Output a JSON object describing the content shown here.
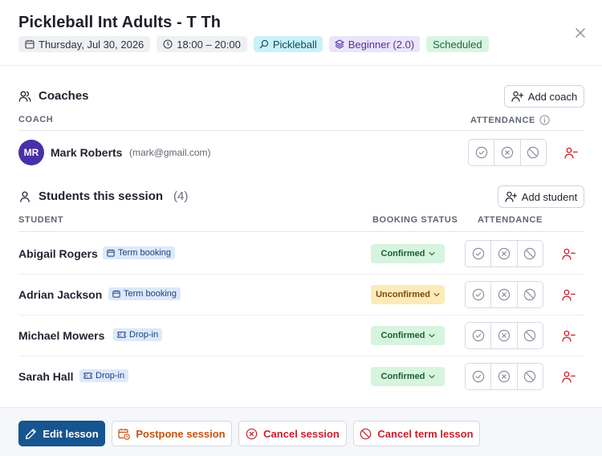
{
  "lesson": {
    "title": "Pickleball Int Adults - T Th",
    "date": "Thursday, Jul 30, 2026",
    "time": "18:00 – 20:00",
    "sport": "Pickleball",
    "level": "Beginner (2.0)",
    "status": "Scheduled"
  },
  "coaches": {
    "heading": "Coaches",
    "add_label": "Add coach",
    "col_coach": "COACH",
    "col_attendance": "ATTENDANCE",
    "items": [
      {
        "initials": "MR",
        "name": "Mark Roberts",
        "email": "(mark@gmail.com)"
      }
    ]
  },
  "students": {
    "heading": "Students this session",
    "count": "(4)",
    "add_label": "Add student",
    "col_student": "STUDENT",
    "col_booking_status": "BOOKING STATUS",
    "col_attendance": "ATTENDANCE",
    "items": [
      {
        "name": "Abigail Rogers",
        "booking_type": "Term booking",
        "booking_status": "Confirmed"
      },
      {
        "name": "Adrian Jackson",
        "booking_type": "Term booking",
        "booking_status": "Unconfirmed"
      },
      {
        "name": "Michael Mowers",
        "booking_type": "Drop-in",
        "booking_status": "Confirmed"
      },
      {
        "name": "Sarah Hall",
        "booking_type": "Drop-in",
        "booking_status": "Confirmed"
      }
    ]
  },
  "footer": {
    "edit_label": "Edit lesson",
    "postpone_label": "Postpone session",
    "cancel_session_label": "Cancel session",
    "cancel_term_label": "Cancel term lesson"
  },
  "colors": {
    "primary": "#16558f",
    "danger": "#c8202d",
    "warning": "#c5510f",
    "avatar": "#4a2fa8"
  }
}
